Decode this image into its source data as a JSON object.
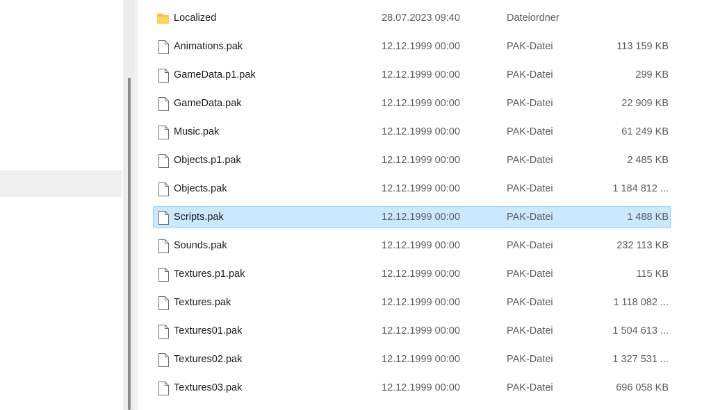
{
  "files": [
    {
      "name": "Localized",
      "date": "28.07.2023 09:40",
      "type": "Dateiordner",
      "size": "",
      "icon": "folder-icon",
      "selected": false
    },
    {
      "name": "Animations.pak",
      "date": "12.12.1999 00:00",
      "type": "PAK-Datei",
      "size": "113 159 KB",
      "icon": "file-icon",
      "selected": false
    },
    {
      "name": "GameData.p1.pak",
      "date": "12.12.1999 00:00",
      "type": "PAK-Datei",
      "size": "299 KB",
      "icon": "file-icon",
      "selected": false
    },
    {
      "name": "GameData.pak",
      "date": "12.12.1999 00:00",
      "type": "PAK-Datei",
      "size": "22 909 KB",
      "icon": "file-icon",
      "selected": false
    },
    {
      "name": "Music.pak",
      "date": "12.12.1999 00:00",
      "type": "PAK-Datei",
      "size": "61 249 KB",
      "icon": "file-icon",
      "selected": false
    },
    {
      "name": "Objects.p1.pak",
      "date": "12.12.1999 00:00",
      "type": "PAK-Datei",
      "size": "2 485 KB",
      "icon": "file-icon",
      "selected": false
    },
    {
      "name": "Objects.pak",
      "date": "12.12.1999 00:00",
      "type": "PAK-Datei",
      "size": "1 184 812 ...",
      "icon": "file-icon",
      "selected": false
    },
    {
      "name": "Scripts.pak",
      "date": "12.12.1999 00:00",
      "type": "PAK-Datei",
      "size": "1 488 KB",
      "icon": "file-icon",
      "selected": true
    },
    {
      "name": "Sounds.pak",
      "date": "12.12.1999 00:00",
      "type": "PAK-Datei",
      "size": "232 113 KB",
      "icon": "file-icon",
      "selected": false
    },
    {
      "name": "Textures.p1.pak",
      "date": "12.12.1999 00:00",
      "type": "PAK-Datei",
      "size": "115 KB",
      "icon": "file-icon",
      "selected": false
    },
    {
      "name": "Textures.pak",
      "date": "12.12.1999 00:00",
      "type": "PAK-Datei",
      "size": "1 118 082 ...",
      "icon": "file-icon",
      "selected": false
    },
    {
      "name": "Textures01.pak",
      "date": "12.12.1999 00:00",
      "type": "PAK-Datei",
      "size": "1 504 613 ...",
      "icon": "file-icon",
      "selected": false
    },
    {
      "name": "Textures02.pak",
      "date": "12.12.1999 00:00",
      "type": "PAK-Datei",
      "size": "1 327 531 ...",
      "icon": "file-icon",
      "selected": false
    },
    {
      "name": "Textures03.pak",
      "date": "12.12.1999 00:00",
      "type": "PAK-Datei",
      "size": "696 058 KB",
      "icon": "file-icon",
      "selected": false
    }
  ],
  "colors": {
    "selection_fill": "#cce8ff",
    "selection_border": "#99d1ff",
    "folder": "#f6c04a",
    "secondary_text": "#5c5c5c"
  }
}
